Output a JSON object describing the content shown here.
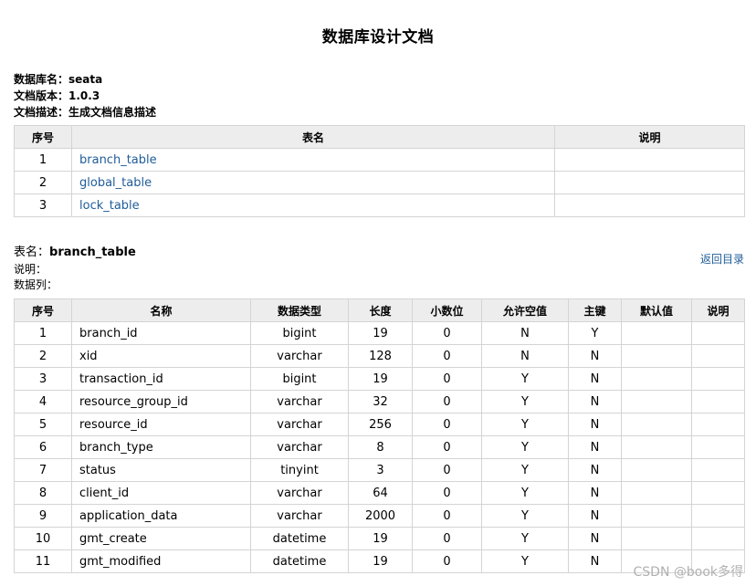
{
  "doc_title": "数据库设计文档",
  "meta": {
    "db_label": "数据库名：",
    "db_value": "seata",
    "version_label": "文档版本：",
    "version_value": "1.0.3",
    "desc_label": "文档描述：",
    "desc_value": "生成文档信息描述"
  },
  "toc": {
    "headers": [
      "序号",
      "表名",
      "说明"
    ],
    "rows": [
      {
        "no": "1",
        "name": "branch_table",
        "desc": ""
      },
      {
        "no": "2",
        "name": "global_table",
        "desc": ""
      },
      {
        "no": "3",
        "name": "lock_table",
        "desc": ""
      }
    ]
  },
  "section": {
    "table_label": "表名：",
    "table_name": "branch_table",
    "desc_label": "说明：",
    "cols_label": "数据列：",
    "back_link": "返回目录"
  },
  "columns": {
    "headers": [
      "序号",
      "名称",
      "数据类型",
      "长度",
      "小数位",
      "允许空值",
      "主键",
      "默认值",
      "说明"
    ],
    "rows": [
      [
        "1",
        "branch_id",
        "bigint",
        "19",
        "0",
        "N",
        "Y",
        "",
        ""
      ],
      [
        "2",
        "xid",
        "varchar",
        "128",
        "0",
        "N",
        "N",
        "",
        ""
      ],
      [
        "3",
        "transaction_id",
        "bigint",
        "19",
        "0",
        "Y",
        "N",
        "",
        ""
      ],
      [
        "4",
        "resource_group_id",
        "varchar",
        "32",
        "0",
        "Y",
        "N",
        "",
        ""
      ],
      [
        "5",
        "resource_id",
        "varchar",
        "256",
        "0",
        "Y",
        "N",
        "",
        ""
      ],
      [
        "6",
        "branch_type",
        "varchar",
        "8",
        "0",
        "Y",
        "N",
        "",
        ""
      ],
      [
        "7",
        "status",
        "tinyint",
        "3",
        "0",
        "Y",
        "N",
        "",
        ""
      ],
      [
        "8",
        "client_id",
        "varchar",
        "64",
        "0",
        "Y",
        "N",
        "",
        ""
      ],
      [
        "9",
        "application_data",
        "varchar",
        "2000",
        "0",
        "Y",
        "N",
        "",
        ""
      ],
      [
        "10",
        "gmt_create",
        "datetime",
        "19",
        "0",
        "Y",
        "N",
        "",
        ""
      ],
      [
        "11",
        "gmt_modified",
        "datetime",
        "19",
        "0",
        "Y",
        "N",
        "",
        ""
      ]
    ]
  },
  "watermark": "CSDN @book多得"
}
